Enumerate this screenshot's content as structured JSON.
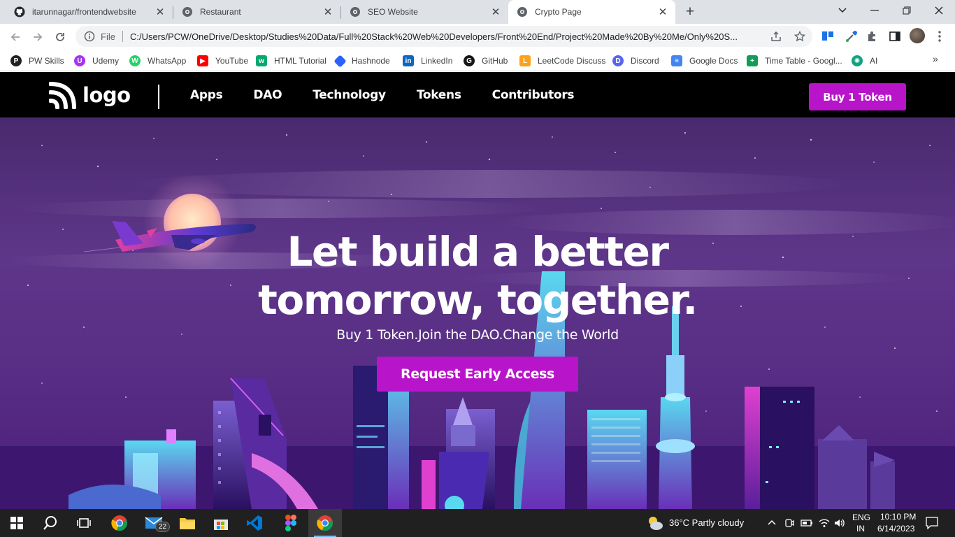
{
  "browser": {
    "tabs": [
      {
        "title": "itarunnagar/frontendwebsite",
        "icon": "github-icon",
        "active": false
      },
      {
        "title": "Restaurant",
        "icon": "globe-icon",
        "active": false
      },
      {
        "title": "SEO Website",
        "icon": "globe-icon",
        "active": false
      },
      {
        "title": "Crypto Page",
        "icon": "globe-icon",
        "active": true
      }
    ],
    "address": {
      "scheme_label": "File",
      "url": "C:/Users/PCW/OneDrive/Desktop/Studies%20Data/Full%20Stack%20Web%20Developers/Front%20End/Project%20Made%20By%20Me/Only%20S..."
    },
    "bookmarks": [
      {
        "label": "PW Skills",
        "color": "#222222"
      },
      {
        "label": "Udemy",
        "color": "#a435f0"
      },
      {
        "label": "WhatsApp",
        "color": "#25d366"
      },
      {
        "label": "YouTube",
        "color": "#ff0000"
      },
      {
        "label": "HTML Tutorial",
        "color": "#04aa6d"
      },
      {
        "label": "Hashnode",
        "color": "#2962ff"
      },
      {
        "label": "LinkedIn",
        "color": "#0a66c2"
      },
      {
        "label": "GitHub",
        "color": "#181717"
      },
      {
        "label": "LeetCode Discuss",
        "color": "#ffa116"
      },
      {
        "label": "Discord",
        "color": "#5865f2"
      },
      {
        "label": "Google Docs",
        "color": "#4285f4"
      },
      {
        "label": "Time Table - Googl...",
        "color": "#0f9d58"
      },
      {
        "label": "AI",
        "color": "#10a37f"
      }
    ]
  },
  "site": {
    "logo_text": "logo",
    "nav": [
      "Apps",
      "DAO",
      "Technology",
      "Tokens",
      "Contributors"
    ],
    "buy_button": "Buy 1 Token",
    "hero": {
      "title_line1": "Let build a better",
      "title_line2": "tomorrow, together.",
      "subtitle": "Buy 1 Token.Join the DAO.Change the World",
      "cta": "Request Early Access"
    },
    "accent_color": "#b814c9"
  },
  "taskbar": {
    "mail_badge": "22",
    "weather": "36°C  Partly cloudy",
    "lang_top": "ENG",
    "lang_bottom": "IN",
    "time": "10:10 PM",
    "date": "6/14/2023"
  }
}
